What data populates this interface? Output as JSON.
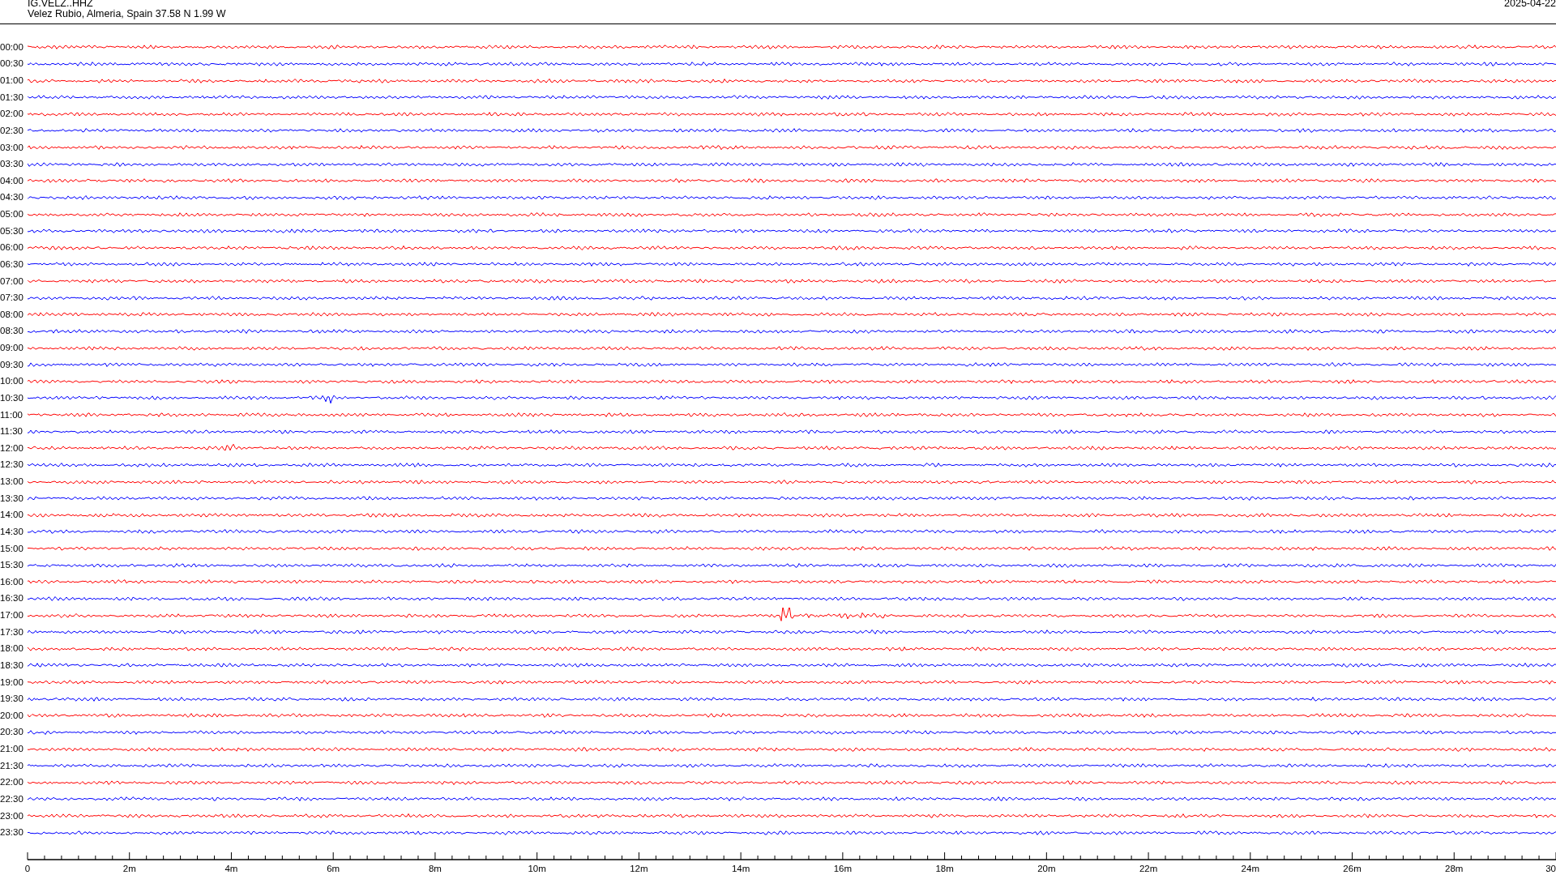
{
  "header": {
    "station": "IG.VELZ..HHZ",
    "location": "Velez Rubio, Almeria, Spain  37.58 N 1.99 W",
    "date": "2025-04-22"
  },
  "rows": [
    {
      "time": "00:00",
      "color": "#ff0000"
    },
    {
      "time": "00:30",
      "color": "#0000ff"
    },
    {
      "time": "01:00",
      "color": "#ff0000"
    },
    {
      "time": "01:30",
      "color": "#0000ff"
    },
    {
      "time": "02:00",
      "color": "#ff0000"
    },
    {
      "time": "02:30",
      "color": "#0000ff"
    },
    {
      "time": "03:00",
      "color": "#ff0000"
    },
    {
      "time": "03:30",
      "color": "#0000ff"
    },
    {
      "time": "04:00",
      "color": "#ff0000"
    },
    {
      "time": "04:30",
      "color": "#0000ff"
    },
    {
      "time": "05:00",
      "color": "#ff0000"
    },
    {
      "time": "05:30",
      "color": "#0000ff"
    },
    {
      "time": "06:00",
      "color": "#ff0000"
    },
    {
      "time": "06:30",
      "color": "#0000ff"
    },
    {
      "time": "07:00",
      "color": "#ff0000"
    },
    {
      "time": "07:30",
      "color": "#0000ff"
    },
    {
      "time": "08:00",
      "color": "#ff0000"
    },
    {
      "time": "08:30",
      "color": "#0000ff"
    },
    {
      "time": "09:00",
      "color": "#ff0000"
    },
    {
      "time": "09:30",
      "color": "#0000ff"
    },
    {
      "time": "10:00",
      "color": "#ff0000"
    },
    {
      "time": "10:30",
      "color": "#0000ff"
    },
    {
      "time": "11:00",
      "color": "#ff0000"
    },
    {
      "time": "11:30",
      "color": "#0000ff"
    },
    {
      "time": "12:00",
      "color": "#ff0000"
    },
    {
      "time": "12:30",
      "color": "#0000ff"
    },
    {
      "time": "13:00",
      "color": "#ff0000"
    },
    {
      "time": "13:30",
      "color": "#0000ff"
    },
    {
      "time": "14:00",
      "color": "#ff0000"
    },
    {
      "time": "14:30",
      "color": "#0000ff"
    },
    {
      "time": "15:00",
      "color": "#ff0000"
    },
    {
      "time": "15:30",
      "color": "#0000ff"
    },
    {
      "time": "16:00",
      "color": "#ff0000"
    },
    {
      "time": "16:30",
      "color": "#0000ff"
    },
    {
      "time": "17:00",
      "color": "#ff0000"
    },
    {
      "time": "17:30",
      "color": "#0000ff"
    },
    {
      "time": "18:00",
      "color": "#ff0000"
    },
    {
      "time": "18:30",
      "color": "#0000ff"
    },
    {
      "time": "19:00",
      "color": "#ff0000"
    },
    {
      "time": "19:30",
      "color": "#0000ff"
    },
    {
      "time": "20:00",
      "color": "#ff0000"
    },
    {
      "time": "20:30",
      "color": "#0000ff"
    },
    {
      "time": "21:00",
      "color": "#ff0000"
    },
    {
      "time": "21:30",
      "color": "#0000ff"
    },
    {
      "time": "22:00",
      "color": "#ff0000"
    },
    {
      "time": "22:30",
      "color": "#0000ff"
    },
    {
      "time": "23:00",
      "color": "#ff0000"
    },
    {
      "time": "23:30",
      "color": "#0000ff"
    }
  ],
  "axis": {
    "ticks": [
      "0",
      "2m",
      "4m",
      "6m",
      "8m",
      "10m",
      "12m",
      "14m",
      "16m",
      "18m",
      "20m",
      "22m",
      "24m",
      "26m",
      "28m",
      "30"
    ]
  }
}
